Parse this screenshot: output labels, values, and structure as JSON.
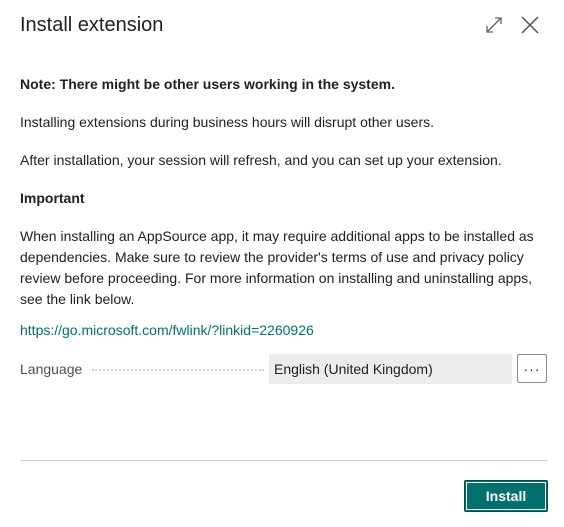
{
  "dialog": {
    "title": "Install extension"
  },
  "icons": {
    "expand": "expand-icon",
    "close": "close-icon"
  },
  "content": {
    "note": "Note: There might be other users working in the system.",
    "paragraph1": "Installing extensions during business hours will disrupt other users.",
    "paragraph2": "After installation, your session will refresh, and you can set up your extension.",
    "important_heading": "Important",
    "paragraph3": "When installing an AppSource app, it may require additional apps to be installed as dependencies. Make sure to review the provider's terms of use and privacy policy review before proceeding. For more information on installing and uninstalling apps, see the link below.",
    "link": "https://go.microsoft.com/fwlink/?linkid=2260926"
  },
  "language": {
    "label": "Language",
    "value": "English (United Kingdom)",
    "lookup_label": "···"
  },
  "footer": {
    "install_label": "Install"
  },
  "colors": {
    "accent": "#00716e",
    "text": "#212121",
    "field_bg": "#ececec"
  }
}
